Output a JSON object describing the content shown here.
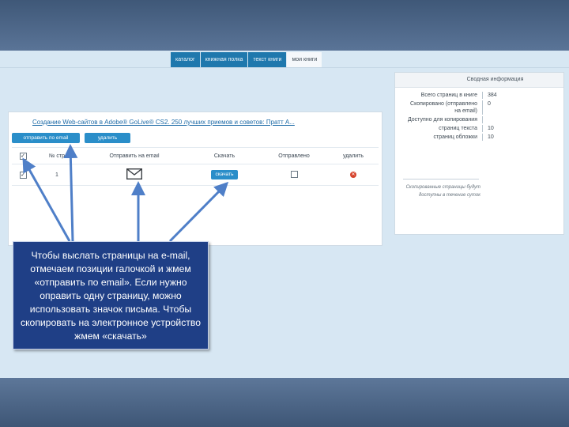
{
  "tabs": [
    {
      "label": "каталог",
      "active": false
    },
    {
      "label": "книжная полка",
      "active": false
    },
    {
      "label": "текст книги",
      "active": false
    },
    {
      "label": "мои книги",
      "active": true
    }
  ],
  "book": {
    "title": "Создание Web-сайтов в Adobe® GoLive® CS2. 250 лучших приемов и советов: Пратт А..."
  },
  "toolbar": {
    "send_label": "отправить по email",
    "delete_label": "удалить"
  },
  "table": {
    "headers": [
      "№ стр",
      "Отправить на email",
      "Скачать",
      "Отправлено",
      "удалить"
    ],
    "rows": [
      {
        "page": "1",
        "download_label": "скачать"
      }
    ]
  },
  "info": {
    "title": "Сводная информация",
    "rows": [
      {
        "label": "Всего страниц в книге",
        "value": "384"
      },
      {
        "label": "Скопировано (отправлено на email)",
        "value": "0"
      },
      {
        "label": "Доступно для копирования",
        "value": ""
      },
      {
        "label": "страниц текста",
        "value": "10"
      },
      {
        "label": "страниц обложки",
        "value": "10"
      }
    ],
    "note": "Скопированные страницы будут доступны в течение суток"
  },
  "callout": {
    "text": "Чтобы выслать страницы на e-mail, отмечаем позиции галочкой и жмем «отправить по email». Если нужно оправить одну страницу, можно использовать значок письма. Чтобы скопировать на электронное устройство жмем «скачать»"
  },
  "colors": {
    "accent": "#2a8ec9",
    "callout_bg": "#1f3f86",
    "arrow": "#4f7fc8",
    "delete": "#d6432c"
  }
}
